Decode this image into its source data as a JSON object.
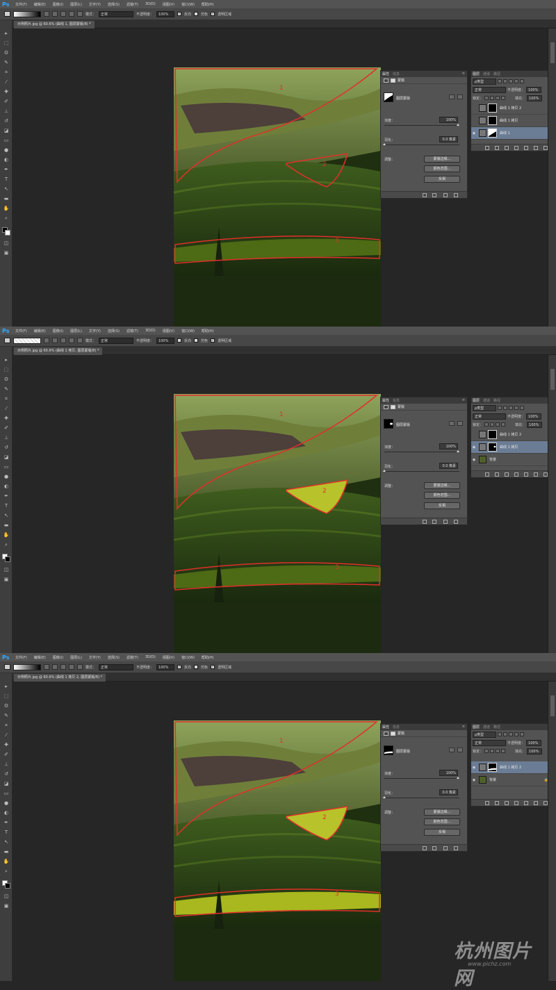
{
  "app": {
    "logo": "Ps"
  },
  "menu": [
    "文件(F)",
    "编辑(E)",
    "图像(I)",
    "图层(L)",
    "文字(Y)",
    "选择(S)",
    "滤镜(T)",
    "3D(D)",
    "视图(V)",
    "窗口(W)",
    "帮助(H)"
  ],
  "options": {
    "mode_label": "模式：",
    "mode_value": "正常",
    "opacity_label": "不透明度：",
    "opacity_value": "100%",
    "reverse_label": "反向",
    "dither_label": "仿色",
    "transparency_label": "透明区域"
  },
  "props_panel": {
    "tab_properties": "属性",
    "tab_info": "信息",
    "subtitle": "蒙版",
    "mask_name": "图层蒙版",
    "density_label": "浓度：",
    "density_value": "100%",
    "feather_label": "羽化：",
    "feather_value": "0.0 像素",
    "refine_label": "调整：",
    "btn_mask_edge": "蒙版边缘...",
    "btn_color_range": "颜色范围...",
    "btn_invert": "反相"
  },
  "layers_panel": {
    "tab_layers": "图层",
    "tab_channels": "通道",
    "tab_paths": "路径",
    "kind": "ρ类型",
    "blend": "正常",
    "opacity_label": "不透明度：",
    "opacity_value": "100%",
    "lock_label": "锁定：",
    "fill_label": "填充：",
    "fill_value": "100%"
  },
  "annotations": {
    "n1": "1",
    "n2": "2",
    "n3": "3"
  },
  "screens": [
    {
      "doc_tab": "示例照片.jpg @ 60.6% (曲线 1, 图层蒙版/8) *",
      "layers": [
        {
          "name": "曲线 1 拷贝 2",
          "visible": false
        },
        {
          "name": "曲线 1 拷贝",
          "visible": false
        },
        {
          "name": "曲线 1",
          "visible": true,
          "selected": true
        }
      ]
    },
    {
      "doc_tab": "示例照片.jpg @ 60.6% (曲线 1 拷贝, 图层蒙版/8) *",
      "layers": [
        {
          "name": "曲线 1 拷贝 2",
          "visible": false
        },
        {
          "name": "曲线 1 拷贝",
          "visible": true,
          "selected": true
        },
        {
          "name": "背景",
          "visible": true
        }
      ]
    },
    {
      "doc_tab": "示例照片.jpg @ 60.6% (曲线 1 拷贝 2, 图层蒙版/8) *",
      "layers": [
        {
          "name": "曲线 1 拷贝 2",
          "visible": true,
          "selected": true
        },
        {
          "name": "背景",
          "visible": true
        }
      ]
    }
  ],
  "watermark": {
    "title": "杭州图片网",
    "url": "www.pichz.com"
  },
  "colors": {
    "ps_blue": "#31a8ff",
    "annotation_red": "#e0302a",
    "selected_layer": "#6b7d95"
  }
}
